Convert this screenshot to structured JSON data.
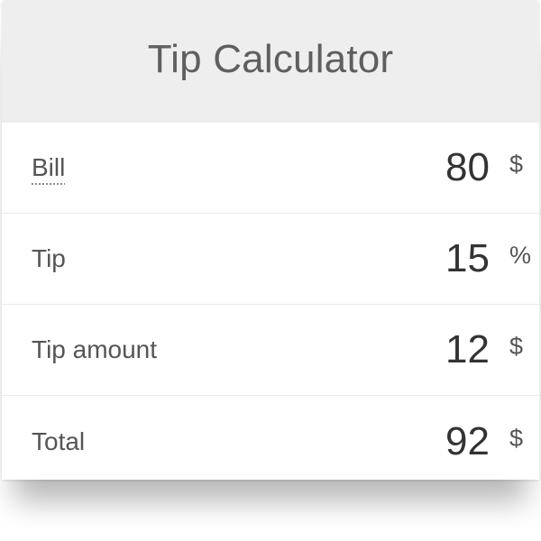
{
  "header": {
    "title": "Tip Calculator"
  },
  "fields": [
    {
      "label": "Bill",
      "value": "80",
      "unit": "$"
    },
    {
      "label": "Tip",
      "value": "15",
      "unit": "%"
    },
    {
      "label": "Tip amount",
      "value": "12",
      "unit": "$"
    },
    {
      "label": "Total",
      "value": "92",
      "unit": "$"
    }
  ],
  "colors": {
    "header_background": "#eeeeee",
    "title_text": "#5f5f5f",
    "label_text": "#555555",
    "value_text": "#333333",
    "divider": "#eaeaea"
  }
}
